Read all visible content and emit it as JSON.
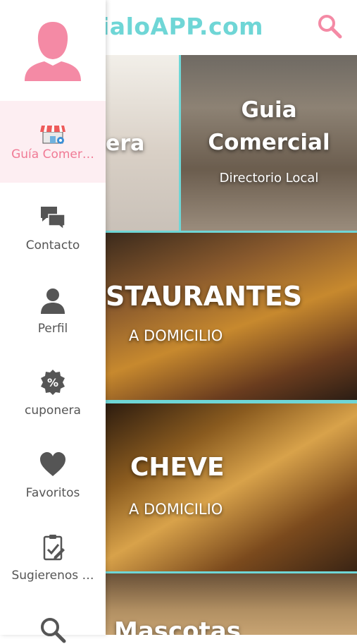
{
  "header": {
    "brand": "GuialoAPP.com",
    "brand_visible": "uialoAPP.com"
  },
  "tiles": {
    "coupon": {
      "title_visible": "era"
    },
    "guide": {
      "title_line1": "Guia",
      "title_line2": "Comercial",
      "subtitle": "Directorio Local"
    },
    "restaurants": {
      "title_visible": "STAURANTES",
      "subtitle": "A DOMICILIO"
    },
    "beer": {
      "title": "CHEVE",
      "subtitle": "A DOMICILIO"
    },
    "pets": {
      "title_visible": "Mascotas"
    }
  },
  "drawer": {
    "items": [
      {
        "label": "Guía Comer…",
        "icon": "shop-icon"
      },
      {
        "label": "Contacto",
        "icon": "chat-icon"
      },
      {
        "label": "Perfil",
        "icon": "user-icon"
      },
      {
        "label": "cuponera",
        "icon": "percent-badge-icon"
      },
      {
        "label": "Favoritos",
        "icon": "heart-icon"
      },
      {
        "label": "Sugierenos …",
        "icon": "clipboard-check-icon"
      }
    ]
  },
  "colors": {
    "accent": "#6fd6d6",
    "pink": "#f48aa5",
    "active_bg": "#fdeef2",
    "icon_gray": "#555555"
  }
}
